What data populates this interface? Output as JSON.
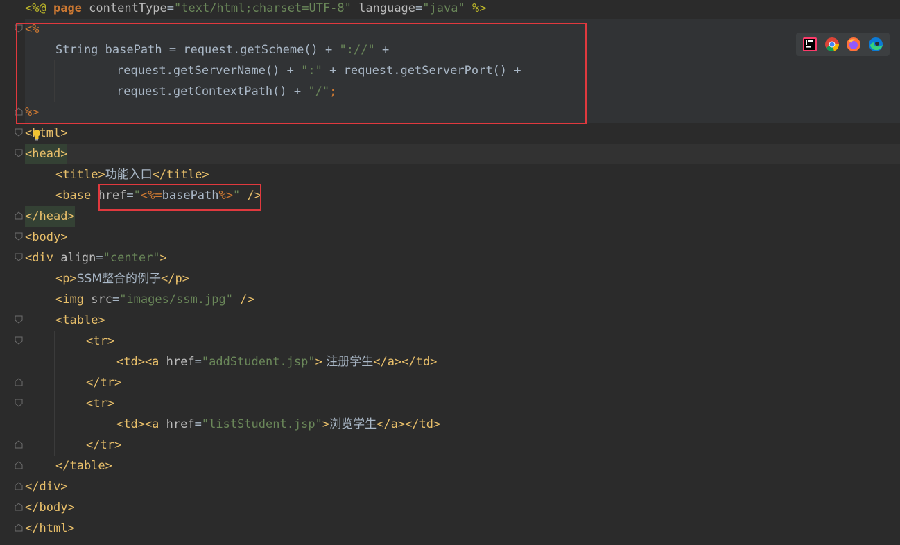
{
  "editor": {
    "lines": {
      "l1": {
        "open": "<%@",
        "kw": "page",
        "a1": "contentType",
        "eq1": "=",
        "v1": "\"text/html;charset=UTF-8\"",
        "a2": "language",
        "eq2": "=",
        "v2": "\"java\"",
        "close": "%>"
      },
      "l2": {
        "open": "<%"
      },
      "l3": {
        "type": "String",
        "name": "basePath",
        "eq": "=",
        "call": "request.getScheme()",
        "plus": "+",
        "s": "\"://\"",
        "plus2": "+"
      },
      "l4": {
        "call1": "request.getServerName()",
        "plus1": "+",
        "s": "\":\"",
        "plus2": "+",
        "call2": "request.getServerPort()",
        "plus3": "+"
      },
      "l5": {
        "call": "request.getContextPath()",
        "plus": "+",
        "s": "\"/\"",
        "semi": ";"
      },
      "l6": {
        "close": "%>"
      },
      "l7": {
        "lt": "<",
        "tag": "html",
        "gt": ">"
      },
      "l8": {
        "lt": "<",
        "tag": "head",
        "gt": ">"
      },
      "l9": {
        "open": "<",
        "tag": "title",
        "gt": ">",
        "text": "功能入口",
        "close_open": "</",
        "close_tag": "title",
        "close_gt": ">"
      },
      "l10": {
        "lt": "<",
        "tag": "base",
        "attr": "href",
        "eq": "=",
        "q1": "\"",
        "expr_open": "<%=",
        "expr": "basePath",
        "expr_close": "%>",
        "q2": "\"",
        "end": "/>"
      },
      "l11": {
        "lt": "</",
        "tag": "head",
        "gt": ">"
      },
      "l12": {
        "lt": "<",
        "tag": "body",
        "gt": ">"
      },
      "l13": {
        "lt": "<",
        "tag": "div",
        "attr": "align",
        "eq": "=",
        "val": "\"center\"",
        "gt": ">"
      },
      "l14": {
        "lt": "<",
        "tag": "p",
        "gt": ">",
        "text": "SSM整合的例子",
        "close_lt": "</",
        "close_tag": "p",
        "close_gt": ">"
      },
      "l15": {
        "lt": "<",
        "tag": "img",
        "attr": "src",
        "eq": "=",
        "val": "\"images/ssm.jpg\"",
        "end": "/>"
      },
      "l16": {
        "lt": "<",
        "tag": "table",
        "gt": ">"
      },
      "l17": {
        "lt": "<",
        "tag": "tr",
        "gt": ">"
      },
      "l18": {
        "td_open": "<td><a",
        "attr": "href",
        "eq": "=",
        "val": "\"addStudent.jsp\"",
        "gt": ">",
        "text": " 注册学生",
        "close": "</a></td>"
      },
      "l19": {
        "lt": "</",
        "tag": "tr",
        "gt": ">"
      },
      "l20": {
        "lt": "<",
        "tag": "tr",
        "gt": ">"
      },
      "l21": {
        "td_open": "<td><a",
        "attr": "href",
        "eq": "=",
        "val": "\"listStudent.jsp\"",
        "gt": ">",
        "text": "浏览学生",
        "close": "</a></td>"
      },
      "l22": {
        "lt": "</",
        "tag": "tr",
        "gt": ">"
      },
      "l23": {
        "lt": "</",
        "tag": "table",
        "gt": ">"
      },
      "l24": {
        "lt": "</",
        "tag": "div",
        "gt": ">"
      },
      "l25": {
        "lt": "</",
        "tag": "body",
        "gt": ">"
      },
      "l26": {
        "lt": "</",
        "tag": "html",
        "gt": ">"
      }
    }
  },
  "browsers": [
    {
      "name": "intellij-icon"
    },
    {
      "name": "chrome-icon"
    },
    {
      "name": "firefox-icon"
    },
    {
      "name": "edge-icon"
    }
  ],
  "colors": {
    "background": "#2b2b2b",
    "highlight_box": "#e0393e",
    "keyword": "#cc7832",
    "string": "#6a8759",
    "tag": "#e8bf6a",
    "text": "#a9b7c6"
  }
}
